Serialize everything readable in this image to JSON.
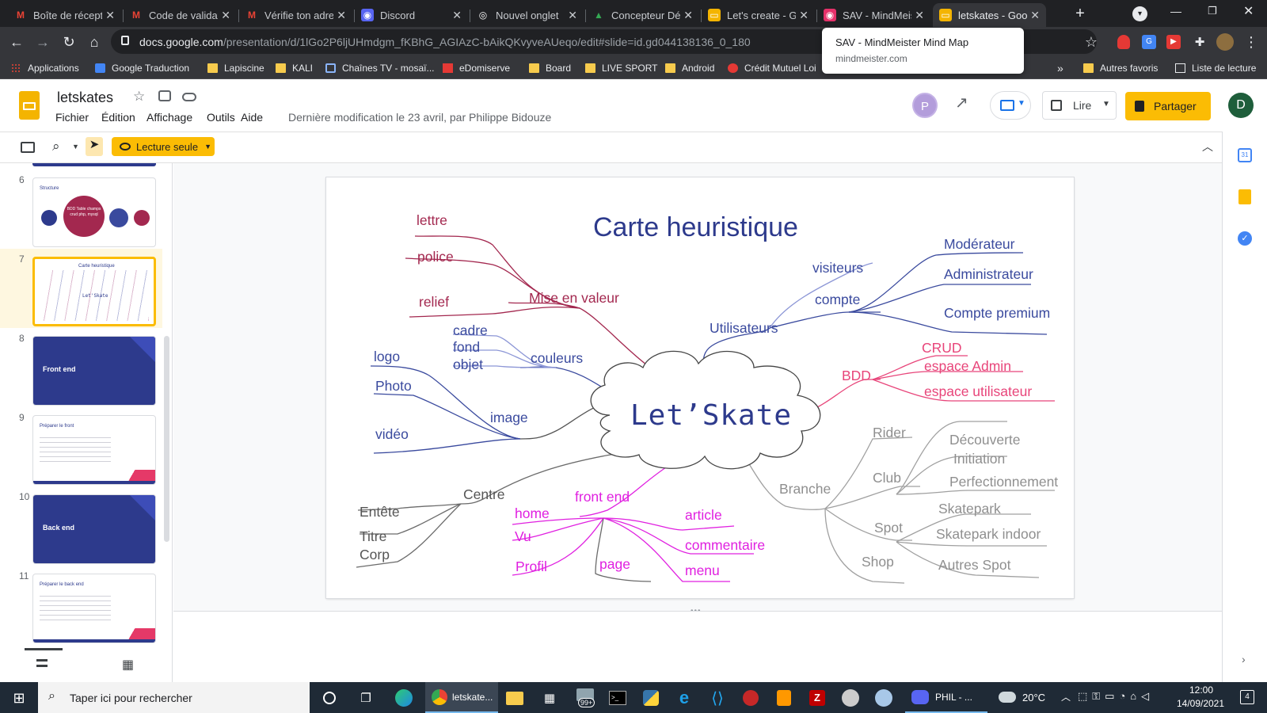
{
  "browser": {
    "tabs": [
      {
        "icon": "gmail-icon",
        "title": "Boîte de récepti",
        "active": false
      },
      {
        "icon": "gmail-icon",
        "title": "Code de validati",
        "active": false
      },
      {
        "icon": "gmail-icon",
        "title": "Vérifie ton adre",
        "active": false
      },
      {
        "icon": "discord-icon",
        "title": "Discord",
        "active": false
      },
      {
        "icon": "chrome-icon",
        "title": "Nouvel onglet",
        "active": false
      },
      {
        "icon": "drive-icon",
        "title": "Concepteur Dév",
        "active": false
      },
      {
        "icon": "slides-icon",
        "title": "Let's create - Go",
        "active": false
      },
      {
        "icon": "mindmeister-icon",
        "title": "SAV - MindMeis",
        "active": false
      },
      {
        "icon": "slides-icon",
        "title": "letskates - Goog",
        "active": true
      }
    ],
    "url_host": "docs.google.com",
    "url_path": "/presentation/d/1lGo2P6ljUHmdgm_fKBhG_AGIAzC-bAikQKvyveAUeqo/edit#slide=id.gd044138136_0_180",
    "bookmarks": [
      "Applications",
      "Google Traduction",
      "Lapiscine",
      "KALI",
      "Chaînes TV - mosaï...",
      "eDomiserve",
      "Board",
      "LIVE SPORT",
      "Android",
      "Crédit Mutuel Loi"
    ],
    "bookmarks_more": "»",
    "other_bookmarks": "Autres favoris",
    "reading_list": "Liste de lecture",
    "hover_popup": {
      "title": "SAV - MindMeister Mind Map",
      "url": "mindmeister.com"
    }
  },
  "doc": {
    "title": "letskates",
    "menus": [
      "Fichier",
      "Édition",
      "Affichage",
      "Outils",
      "Aide"
    ],
    "last_modified": "Dernière modification le 23 avril, par Philippe Bidouze",
    "avatar_p": "P",
    "avatar_d": "D",
    "present_label": "Lire",
    "share_label": "Partager",
    "readonly_label": "Lecture seule"
  },
  "filmstrip": {
    "slides": [
      {
        "num": "6",
        "title": "Structure",
        "kind": "structure",
        "bdd_text": "BDD Table champs crud php, mysql"
      },
      {
        "num": "7",
        "title": "Carte heuristique",
        "kind": "mindmap",
        "center": "Let'Skate"
      },
      {
        "num": "8",
        "title": "Front end",
        "kind": "section"
      },
      {
        "num": "9",
        "title": "Préparer le front",
        "kind": "text"
      },
      {
        "num": "10",
        "title": "Back end",
        "kind": "section"
      },
      {
        "num": "11",
        "title": "Préparer le back end",
        "kind": "text"
      }
    ]
  },
  "slide": {
    "title": "Carte heuristique",
    "center": "Let’Skate",
    "colors": {
      "title": "#2d3a8c",
      "red": "#a3284f",
      "blue": "#3a4a9e",
      "pink": "#e8457a",
      "gray": "#8f8f8f",
      "magenta": "#e020e0",
      "darkgray": "#555555"
    },
    "branches": {
      "mise_en_valeur": {
        "label": "Mise en valeur",
        "children": [
          "lettre",
          "police",
          "relief"
        ]
      },
      "couleurs": {
        "label": "couleurs",
        "children": [
          "cadre",
          "fond",
          "objet"
        ]
      },
      "image": {
        "label": "image",
        "children": [
          "logo",
          "Photo",
          "vidéo"
        ]
      },
      "centre": {
        "label": "Centre",
        "children": [
          "Entête",
          "Titre",
          "Corp"
        ]
      },
      "front_end": {
        "label": "front end",
        "children": [
          "home",
          "Vu",
          "Profil",
          "page",
          "article",
          "commentaire",
          "menu"
        ]
      },
      "utilisateurs": {
        "label": "Utilisateurs",
        "visiteurs": "visiteurs",
        "compte": "compte",
        "compte_children": [
          "Modérateur",
          "Administrateur",
          "Compte premium"
        ]
      },
      "bdd": {
        "label": "BDD",
        "children": [
          "CRUD",
          "espace Admin",
          "espace utilisateur"
        ]
      },
      "branche": {
        "label": "Branche",
        "rider": "Rider",
        "club": "Club",
        "club_children": [
          "Découverte",
          "Initiation",
          "Perfectionnement"
        ],
        "spot": "Spot",
        "spot_children": [
          "Skatepark",
          "Skatepark indoor",
          "Autres Spot"
        ],
        "shop": "Shop"
      }
    }
  },
  "taskbar": {
    "search_placeholder": "Taper ici pour rechercher",
    "chrome_label": "letskate...",
    "discord_label": "PHIL - ...",
    "badge": "99+",
    "weather": "20°C",
    "time": "12:00",
    "date": "14/09/2021",
    "notif": "4"
  }
}
